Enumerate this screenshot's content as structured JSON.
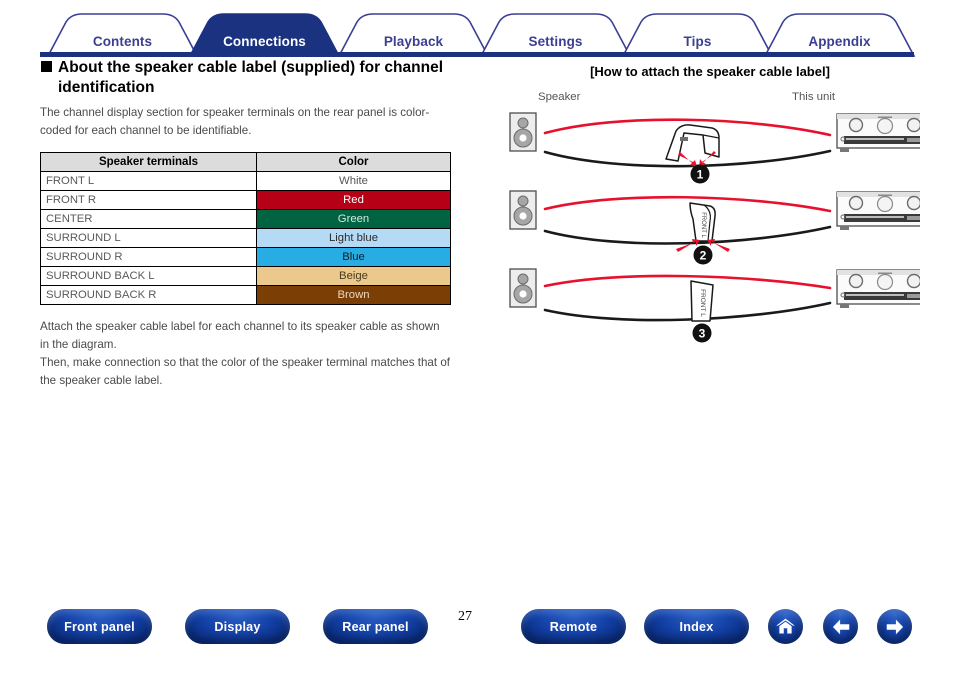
{
  "tabs": [
    {
      "label": "Contents",
      "active": false
    },
    {
      "label": "Connections",
      "active": true
    },
    {
      "label": "Playback",
      "active": false
    },
    {
      "label": "Settings",
      "active": false
    },
    {
      "label": "Tips",
      "active": false
    },
    {
      "label": "Appendix",
      "active": false
    }
  ],
  "section": {
    "heading": "About the speaker cable label (supplied) for channel identification",
    "intro": "The channel display section for speaker terminals on the rear panel is color-coded for each channel to be identifiable.",
    "outro_1": "Attach the speaker cable label for each channel to its speaker cable as shown in the diagram.",
    "outro_2": "Then, make connection so that the color of the speaker terminal matches that of the speaker cable label."
  },
  "table": {
    "headers": [
      "Speaker terminals",
      "Color"
    ],
    "rows": [
      {
        "terminal": "FRONT L",
        "color": "White",
        "swatch": "#ffffff",
        "text_color": "#555555"
      },
      {
        "terminal": "FRONT R",
        "color": "Red",
        "swatch": "#b60016",
        "text_color": "#ffffff"
      },
      {
        "terminal": "CENTER",
        "color": "Green",
        "swatch": "#006341",
        "text_color": "#d8e8df"
      },
      {
        "terminal": "SURROUND L",
        "color": "Light blue",
        "swatch": "#b4daf5",
        "text_color": "#2b2b2b"
      },
      {
        "terminal": "SURROUND R",
        "color": "Blue",
        "swatch": "#27ade4",
        "text_color": "#1a1a1a"
      },
      {
        "terminal": "SURROUND BACK L",
        "color": "Beige",
        "swatch": "#ebc98d",
        "text_color": "#4a3b1c"
      },
      {
        "terminal": "SURROUND BACK R",
        "color": "Brown",
        "swatch": "#7b3f06",
        "text_color": "#e8d8c2"
      }
    ]
  },
  "diagram": {
    "title": "[How to attach the speaker cable label]",
    "label_left": "Speaker",
    "label_right": "This unit",
    "steps": [
      {
        "number": "1",
        "tag_text": ""
      },
      {
        "number": "2",
        "tag_text": "FRONT L"
      },
      {
        "number": "3",
        "tag_text": "FRONT L"
      }
    ]
  },
  "bottom_nav": {
    "page_number": "27",
    "buttons": [
      {
        "label": "Front panel"
      },
      {
        "label": "Display"
      },
      {
        "label": "Rear panel"
      },
      {
        "label": "Remote"
      },
      {
        "label": "Index"
      }
    ],
    "icons": [
      {
        "name": "home-icon"
      },
      {
        "name": "arrow-left-icon"
      },
      {
        "name": "arrow-right-icon"
      }
    ]
  },
  "colors": {
    "tab_active_bg": "#1b3281",
    "tab_border": "#3b3f93",
    "tab_text": "#3b3f93",
    "underline_bar": "#1b3281",
    "pill_blue": "#0b2f83",
    "cable_red": "#e8112d",
    "cable_black": "#1a1a1a"
  }
}
